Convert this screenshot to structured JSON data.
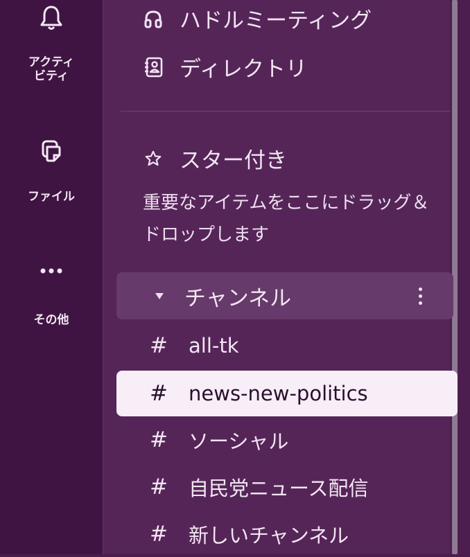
{
  "rail": {
    "activity": {
      "label": "アクティ\nビティ",
      "icon": "bell-icon"
    },
    "files": {
      "label": "ファイル",
      "icon": "files-icon"
    },
    "more": {
      "label": "その他",
      "icon": "more-icon"
    }
  },
  "nav": {
    "huddle": {
      "label": "ハドルミーティング",
      "icon": "headphones-icon"
    },
    "directory": {
      "label": "ディレクトリ",
      "icon": "contact-book-icon"
    }
  },
  "starred": {
    "label": "スター付き",
    "icon": "star-icon",
    "hint": "重要なアイテムをここにドラッグ＆ドロップします"
  },
  "channels": {
    "title": "チャンネル",
    "items": [
      {
        "prefix": "#",
        "name": "all-tk"
      },
      {
        "prefix": "#",
        "name": "news-new-politics"
      },
      {
        "prefix": "#",
        "name": "ソーシャル"
      },
      {
        "prefix": "#",
        "name": "自民党ニュース配信"
      },
      {
        "prefix": "#",
        "name": "新しいチャンネル"
      }
    ],
    "active_index": 1
  },
  "colors": {
    "rail_bg": "#3f1442",
    "panel_bg": "#552558",
    "active_bg": "#f7eef8"
  }
}
